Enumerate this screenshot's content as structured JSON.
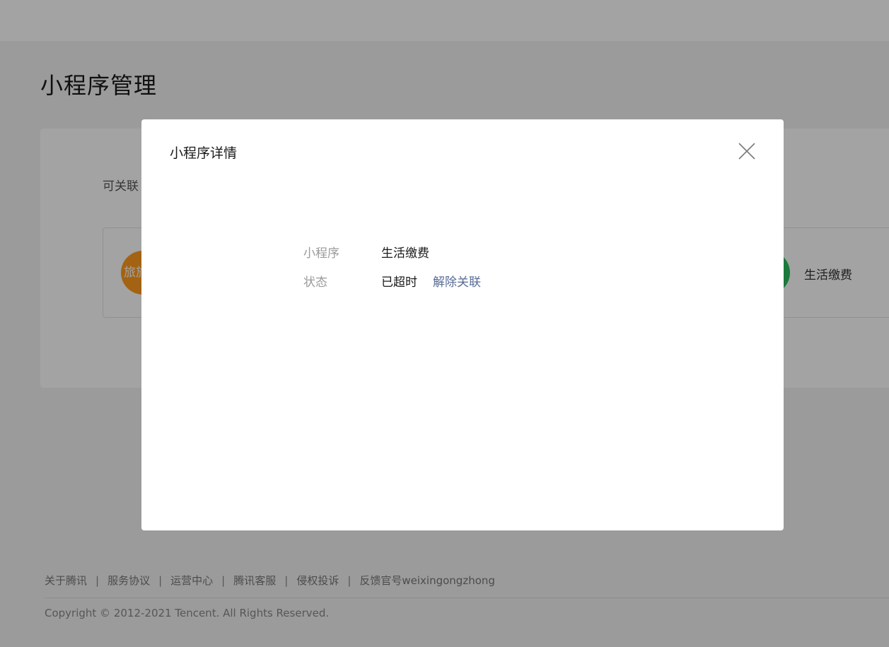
{
  "page": {
    "title": "小程序管理",
    "linkable_label": "可关联"
  },
  "cards": [
    {
      "avatar_text": "旅旅",
      "name": ""
    },
    {
      "avatar_text": "",
      "name": "生活缴费"
    }
  ],
  "modal": {
    "title": "小程序详情",
    "rows": {
      "mp_label": "小程序",
      "mp_value": "生活缴费",
      "status_label": "状态",
      "status_value": "已超时",
      "unlink_label": "解除关联"
    }
  },
  "footer": {
    "links": [
      "关于腾讯",
      "服务协议",
      "运营中心",
      "腾讯客服",
      "侵权投诉",
      "反馈官号weixingongzhong"
    ],
    "separator": "|",
    "copyright": "Copyright © 2012-2021 Tencent. All Rights Reserved."
  },
  "colors": {
    "link": "#576b95",
    "overlay": "rgba(0,0,0,0.36)",
    "avatar_orange": "#ff9b1f",
    "avatar_green": "#2bbd5e"
  }
}
